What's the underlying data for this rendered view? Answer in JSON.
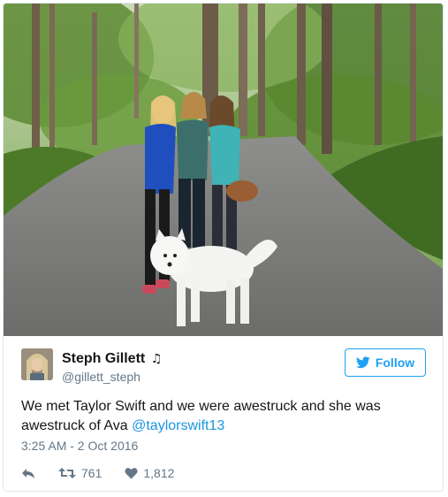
{
  "tweet": {
    "author_name": "Steph Gillett",
    "author_name_suffix": "♫",
    "author_handle": "@gillett_steph",
    "follow_label": "Follow",
    "text_main": "We met Taylor Swift and we were awestruck and she was awestruck of Ava ",
    "text_mention": "@taylorswift13",
    "timestamp": "3:25 AM - 2 Oct 2016",
    "retweet_count": "761",
    "like_count": "1,812"
  },
  "icons": {
    "follow": "twitter-bird-icon",
    "reply": "reply-icon",
    "retweet": "retweet-icon",
    "like": "heart-icon"
  },
  "colors": {
    "accent": "#1da1f2",
    "mention": "#1b95e0",
    "muted": "#657786",
    "text": "#14171a",
    "border": "#e1e8ed"
  }
}
